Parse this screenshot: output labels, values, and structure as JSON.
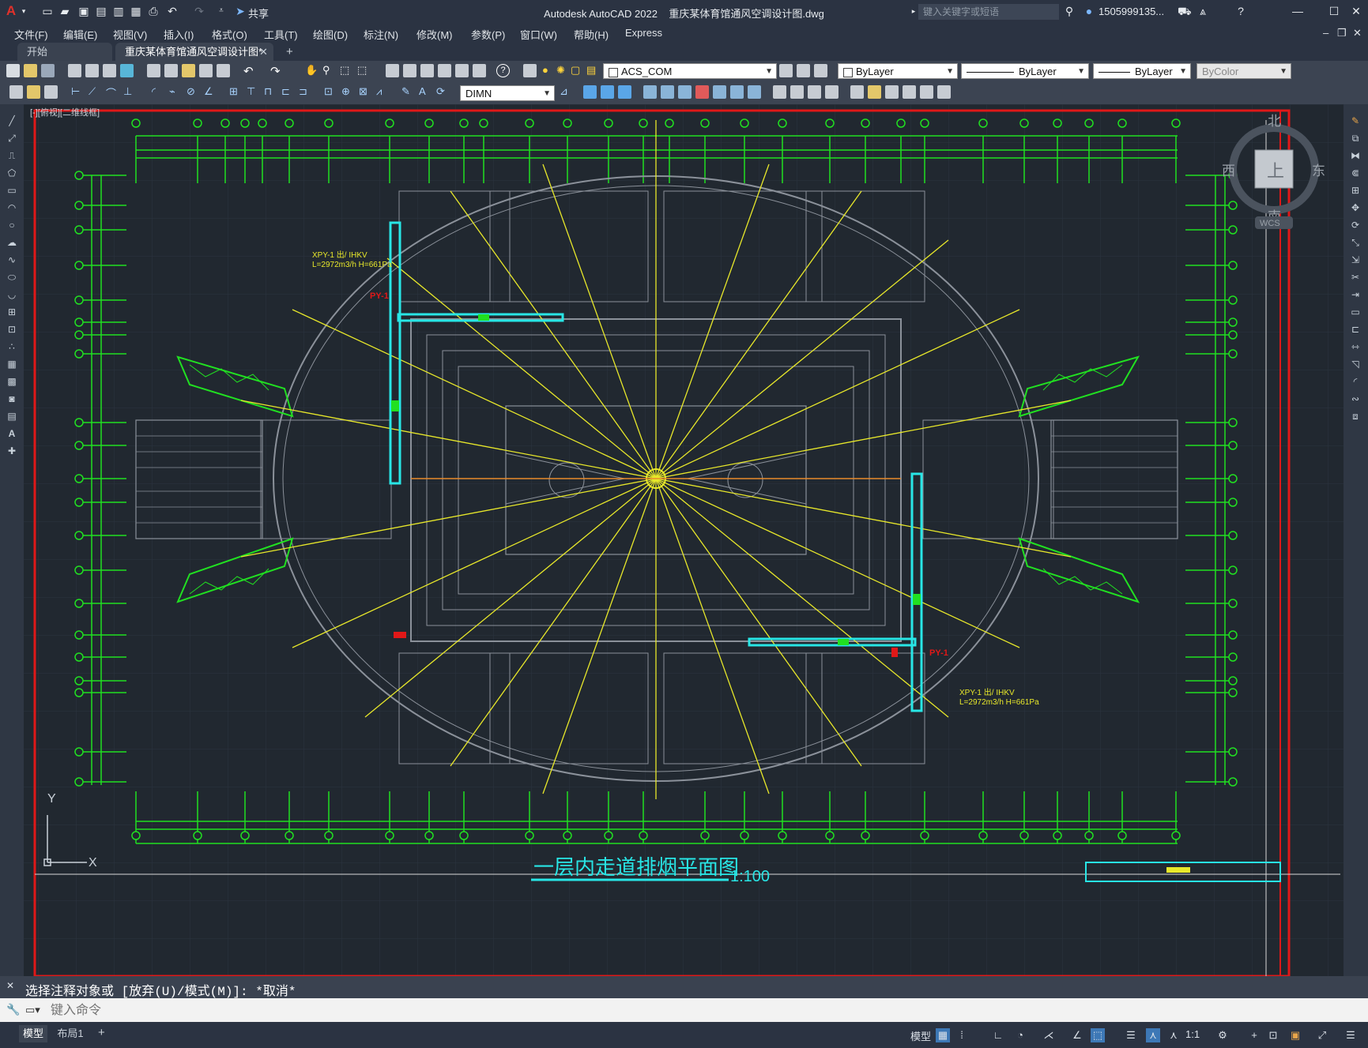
{
  "titlebar": {
    "app_name": "Autodesk AutoCAD 2022",
    "file_name": "重庆某体育馆通风空调设计图.dwg",
    "search_placeholder": "键入关键字或短语",
    "user": "1505999135...",
    "share_label": "共享"
  },
  "menu": [
    "文件(F)",
    "编辑(E)",
    "视图(V)",
    "插入(I)",
    "格式(O)",
    "工具(T)",
    "绘图(D)",
    "标注(N)",
    "修改(M)",
    "参数(P)",
    "窗口(W)",
    "帮助(H)",
    "Express"
  ],
  "tabs": [
    {
      "label": "开始"
    },
    {
      "label": "重庆某体育馆通风空调设计图*"
    }
  ],
  "toolbar": {
    "layer_name": "ACS_COM",
    "color": "ByLayer",
    "linetype": "ByLayer",
    "lineweight": "ByLayer",
    "plotstyle": "ByColor",
    "dimstyle": "DIMN"
  },
  "viewport": {
    "label": "[-][俯视][二维线框]",
    "viewcube": {
      "north": "北",
      "south": "南",
      "east": "东",
      "west": "西",
      "top": "上",
      "wcs": "WCS"
    },
    "ucs_x": "X",
    "ucs_y": "Y"
  },
  "drawing": {
    "title": "一层内走道排烟平面图",
    "scale": "1:100",
    "annotations": [
      "PY-1",
      "XPY-1 出/ IHKV",
      "L=2972m3/h H=661Pa"
    ]
  },
  "command": {
    "history": "选择注释对象或 [放弃(U)/模式(M)]: *取消*",
    "input_placeholder": "键入命令"
  },
  "layout_tabs": [
    "模型",
    "布局1"
  ],
  "status": {
    "model_label": "模型",
    "scale_label": "1:1"
  },
  "colors": {
    "canvas": "#212830",
    "grid_line": "#21e021",
    "yellow": "#e8e82a",
    "cyan": "#28e6e6",
    "red": "#e01818",
    "wall": "#8b919a"
  }
}
